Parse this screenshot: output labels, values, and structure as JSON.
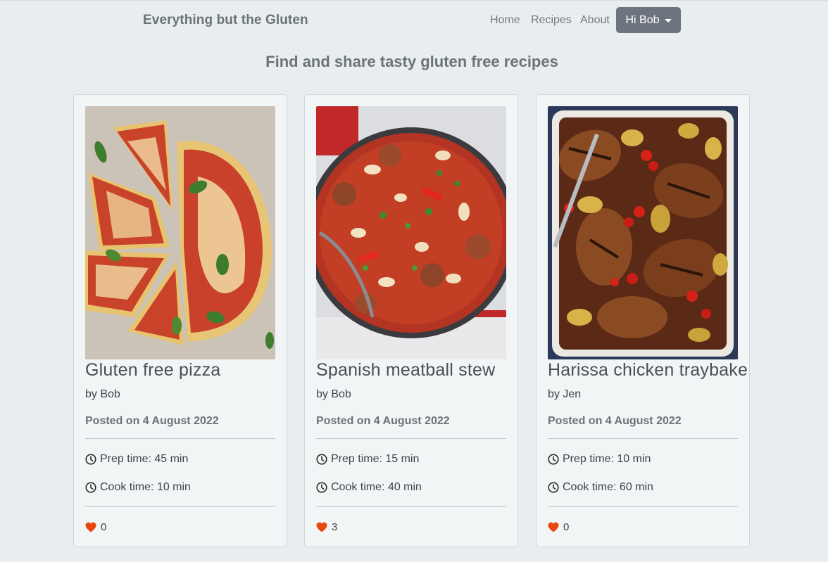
{
  "navbar": {
    "brand": "Everything but the Gluten",
    "links": [
      "Home",
      "Recipes",
      "About"
    ],
    "user_button": "Hi Bob"
  },
  "headline": "Find and share tasty gluten free recipes",
  "labels": {
    "prep_prefix": "Prep time: ",
    "cook_prefix": "Cook time: "
  },
  "recipes": [
    {
      "title": "Gluten free pizza",
      "author": "by Bob",
      "date": "Posted on 4 August 2022",
      "prep": "Prep time: 45 min",
      "cook": "Cook time: 10 min",
      "likes": "0"
    },
    {
      "title": "Spanish meatball stew",
      "author": "by Bob",
      "date": "Posted on 4 August 2022",
      "prep": "Prep time: 15 min",
      "cook": "Cook time: 40 min",
      "likes": "3"
    },
    {
      "title": "Harissa chicken traybake",
      "author": "by Jen",
      "date": "Posted on 4 August 2022",
      "prep": "Prep time: 10 min",
      "cook": "Cook time: 60 min",
      "likes": "0"
    }
  ],
  "colors": {
    "background": "#e8eef0",
    "card": "#f2f5f6",
    "user_button": "#6c757d",
    "heart": "#e8450f"
  },
  "icons": {
    "clock": "clock-icon",
    "heart": "heart-icon",
    "caret": "caret-down-icon"
  }
}
